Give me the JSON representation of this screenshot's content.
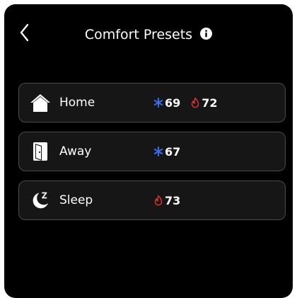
{
  "header": {
    "title": "Comfort Presets",
    "back_icon": "chevron-left-icon",
    "info_icon": "info-icon"
  },
  "presets": [
    {
      "name": "Home",
      "icon": "home-icon",
      "cool": "69",
      "heat": "72"
    },
    {
      "name": "Away",
      "icon": "door-icon",
      "cool": "67"
    },
    {
      "name": "Sleep",
      "icon": "moon-sleep-icon",
      "heat": "73"
    }
  ],
  "colors": {
    "background": "#000000",
    "card": "#161616",
    "card_border": "#4a4a4a",
    "cool": "#3a6cf0",
    "heat": "#e0342c",
    "text": "#ffffff"
  }
}
